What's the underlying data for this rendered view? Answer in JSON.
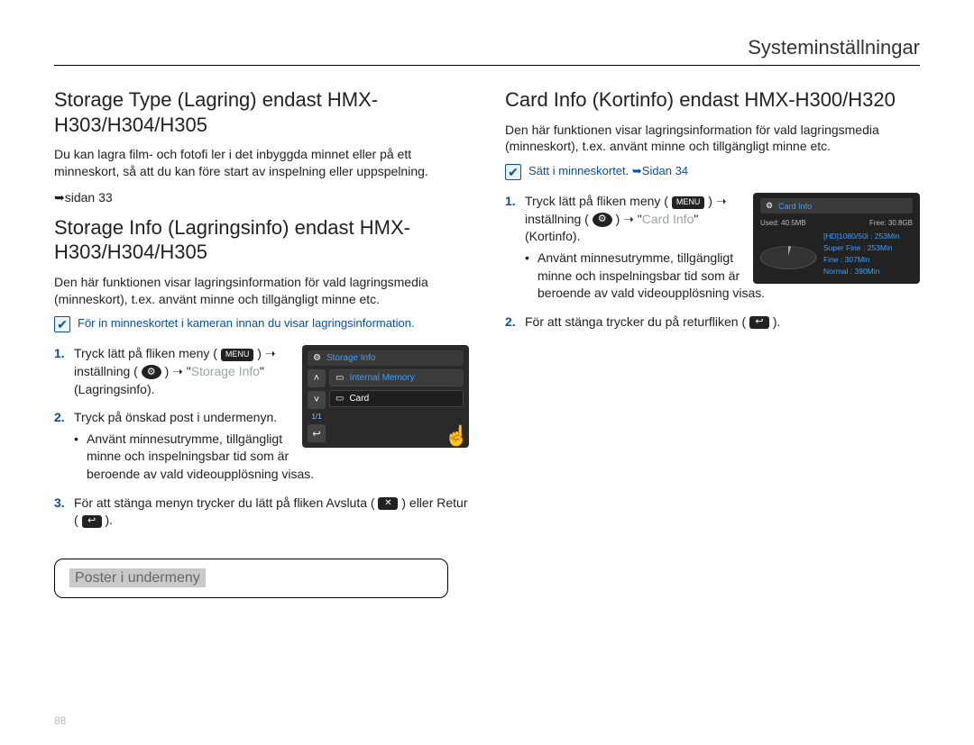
{
  "header": {
    "title": "Systeminställningar"
  },
  "left": {
    "section1": {
      "title": "Storage Type (Lagring) endast HMX-H303/H304/H305",
      "body": "Du kan lagra film- och fotofi ler i det inbyggda minnet eller på ett minneskort, så att du kan före start av inspelning eller uppspelning.",
      "pageref": "➥sidan 33"
    },
    "section2": {
      "title": "Storage Info (Lagringsinfo) endast HMX-H303/H304/H305",
      "body": "Den här funktionen visar lagringsinformation för vald lagringsmedia (minneskort), t.ex. använt minne och tillgängligt minne etc.",
      "note": "För in minneskortet i kameran innan du visar lagringsinformation.",
      "steps": {
        "s1a": "Tryck lätt på fliken meny (",
        "s1b": ") ➝ inställning (",
        "s1c": ") ➝ \"",
        "s1c_label": "Storage Info",
        "s1d": "\" (Lagringsinfo).",
        "s2a": "Tryck på önskad post i undermenyn.",
        "s2b": "Använt minnesutrymme, tillgängligt minne och inspelningsbar tid som är beroende av vald videoupplösning visas.",
        "s3a": "För att stänga menyn trycker du lätt på fliken Avsluta (",
        "s3b": ") eller Retur (",
        "s3c": ")."
      },
      "screen": {
        "title": "Storage Info",
        "item1": "Internal Memory",
        "item2": "Card",
        "pager": "1/1"
      }
    },
    "submenu_label": "Poster i undermeny"
  },
  "right": {
    "section": {
      "title": "Card Info (Kortinfo) endast HMX-H300/H320",
      "body": "Den här funktionen visar lagringsinformation för vald lagringsmedia (minneskort), t.ex. använt minne och tillgängligt minne etc.",
      "note": "Sätt i minneskortet. ➥Sidan 34",
      "steps": {
        "s1a": "Tryck lätt på fliken meny (",
        "s1b": ") ➝ inställning (",
        "s1c": ") ➝ \"",
        "s1c_label": "Card Info",
        "s1d": "\" (Kortinfo).",
        "s1e": "Använt minnesutrymme, tillgängligt minne och inspelningsbar tid som är beroende av vald videoupplösning visas.",
        "s2a": "För att stänga trycker du på returfliken (",
        "s2b": ")."
      },
      "screen": {
        "title": "Card Info",
        "used": "Used: 40.5MB",
        "free": "Free: 30.8GB",
        "legend": [
          {
            "label": "[HD]1080/50i",
            "val": "253Min"
          },
          {
            "label": "Super Fine",
            "val": "253Min"
          },
          {
            "label": "Fine",
            "val": "307Min"
          },
          {
            "label": "Normal",
            "val": "390Min"
          }
        ]
      }
    }
  },
  "pagenum": "88"
}
